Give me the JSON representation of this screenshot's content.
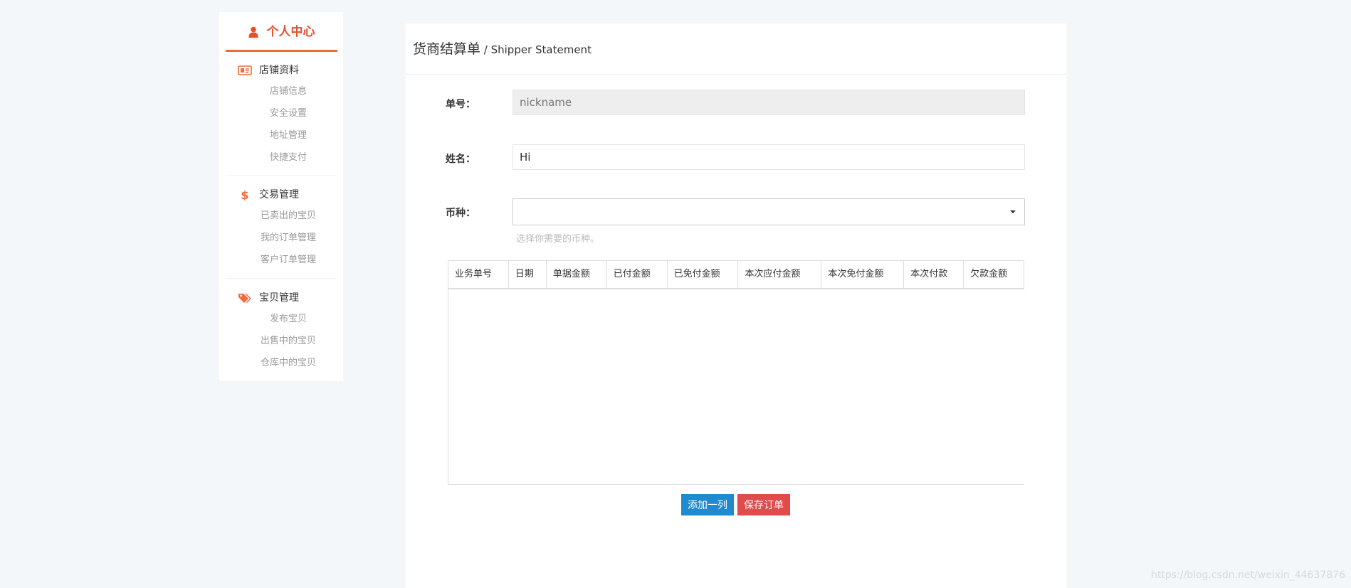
{
  "sidebar": {
    "header": "个人中心",
    "sections": [
      {
        "title": "店铺资料",
        "icon": "id-card-icon",
        "items": [
          "店铺信息",
          "安全设置",
          "地址管理",
          "快捷支付"
        ]
      },
      {
        "title": "交易管理",
        "icon": "dollar-icon",
        "items": [
          "已卖出的宝贝",
          "我的订单管理",
          "客户订单管理"
        ]
      },
      {
        "title": "宝贝管理",
        "icon": "tags-icon",
        "items": [
          "发布宝贝",
          "出售中的宝贝",
          "仓库中的宝贝"
        ]
      }
    ]
  },
  "main": {
    "title_cn": "货商结算单",
    "title_sep": " / ",
    "title_en": "Shipper Statement"
  },
  "form": {
    "order_no_label": "单号：",
    "order_no_placeholder": "nickname",
    "name_label": "姓名：",
    "name_value": "Hi",
    "currency_label": "币种：",
    "currency_value": "",
    "currency_help": "选择你需要的币种。"
  },
  "table": {
    "columns": [
      "业务单号",
      "日期",
      "单据金额",
      "已付金额",
      "已免付金额",
      "本次应付金额",
      "本次免付金额",
      "本次付款",
      "欠款金额"
    ]
  },
  "buttons": {
    "add_row": "添加一列",
    "save_order": "保存订单"
  },
  "watermark": "https://blog.csdn.net/weixin_44637876",
  "colors": {
    "accent": "#f06a3b",
    "header_red": "#e8502a",
    "button_blue": "#1e8bd0",
    "button_red": "#e04c4c"
  }
}
